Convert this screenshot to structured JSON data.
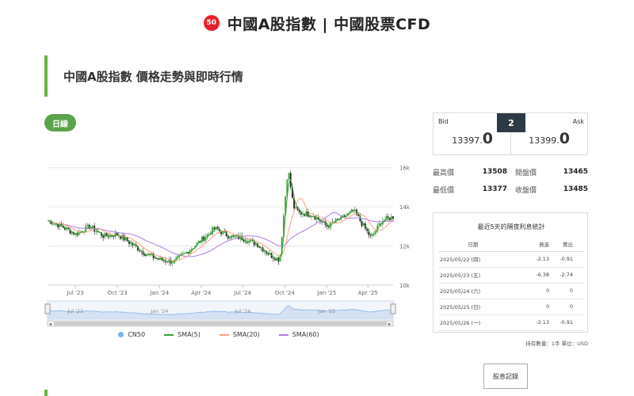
{
  "header": {
    "badge": "50",
    "title": "中國A股指數 | 中國股票CFD"
  },
  "section": {
    "title": "中國A股指數 價格走勢與即時行情"
  },
  "period_button": "日線",
  "quote": {
    "bid_label": "Bid",
    "ask_label": "Ask",
    "spread": "2",
    "bid_main": "13397.",
    "bid_last": "0",
    "ask_main": "13399.",
    "ask_last": "0"
  },
  "stats": {
    "high_label": "最高價",
    "high": "13508",
    "open_label": "開盤價",
    "open": "13465",
    "low_label": "最低價",
    "low": "13377",
    "close_label": "收盤價",
    "close": "13485"
  },
  "swap": {
    "title": "最近5天的隔夜利息統計",
    "headers": [
      "日期",
      "買進",
      "賣出"
    ],
    "rows": [
      [
        "2025/05/22 (四)",
        "-2.13",
        "-0.91"
      ],
      [
        "2025/05/23 (五)",
        "-6.38",
        "-2.74"
      ],
      [
        "2025/05/24 (六)",
        "0",
        "0"
      ],
      [
        "2025/05/25 (日)",
        "0",
        "0"
      ],
      [
        "2025/05/26 (一)",
        "-2.13",
        "-0.91"
      ]
    ],
    "note": "持有數量：1手 單位：USD"
  },
  "record_button": "股息記錄",
  "legend": [
    {
      "name": "CN50",
      "color": "#7cb5ec",
      "kind": "dot"
    },
    {
      "name": "SMA(5)",
      "color": "#3aa335",
      "kind": "line"
    },
    {
      "name": "SMA(20)",
      "color": "#f4a582",
      "kind": "line"
    },
    {
      "name": "SMA(60)",
      "color": "#b07ae6",
      "kind": "line"
    }
  ],
  "chart_data": {
    "type": "candlestick",
    "x_tick_labels": [
      "Jul '23",
      "Oct '23",
      "Jan '24",
      "Apr '24",
      "Jul '24",
      "Oct '24",
      "Jan '25",
      "Apr '25"
    ],
    "navigator_tick_labels": [
      "Jul '23",
      "Jan '24",
      "Jul '24",
      "Jan '25"
    ],
    "y_ticks": [
      10000,
      12000,
      14000,
      16000
    ],
    "y_tick_labels": [
      "10k",
      "12k",
      "14k",
      "16k"
    ],
    "ylim": [
      10000,
      17000
    ],
    "x_range": [
      "2023-05-01",
      "2025-05-26"
    ],
    "series": [
      {
        "name": "CN50",
        "points": [
          [
            "2023-05-01",
            13300
          ],
          [
            "2023-06-01",
            13000
          ],
          [
            "2023-07-01",
            12600
          ],
          [
            "2023-08-01",
            13000
          ],
          [
            "2023-09-01",
            12500
          ],
          [
            "2023-10-01",
            12600
          ],
          [
            "2023-11-01",
            12100
          ],
          [
            "2023-12-01",
            11600
          ],
          [
            "2024-01-01",
            11300
          ],
          [
            "2024-02-01",
            11200
          ],
          [
            "2024-03-01",
            11700
          ],
          [
            "2024-04-01",
            12300
          ],
          [
            "2024-05-01",
            12900
          ],
          [
            "2024-06-01",
            12500
          ],
          [
            "2024-07-01",
            12400
          ],
          [
            "2024-08-01",
            12100
          ],
          [
            "2024-09-01",
            11500
          ],
          [
            "2024-09-20",
            11300
          ],
          [
            "2024-10-08",
            16000
          ],
          [
            "2024-10-20",
            14000
          ],
          [
            "2024-11-01",
            13700
          ],
          [
            "2024-12-01",
            13600
          ],
          [
            "2025-01-01",
            13000
          ],
          [
            "2025-02-01",
            13400
          ],
          [
            "2025-03-01",
            13800
          ],
          [
            "2025-04-08",
            12400
          ],
          [
            "2025-05-01",
            13300
          ],
          [
            "2025-05-26",
            13485
          ]
        ]
      }
    ]
  }
}
